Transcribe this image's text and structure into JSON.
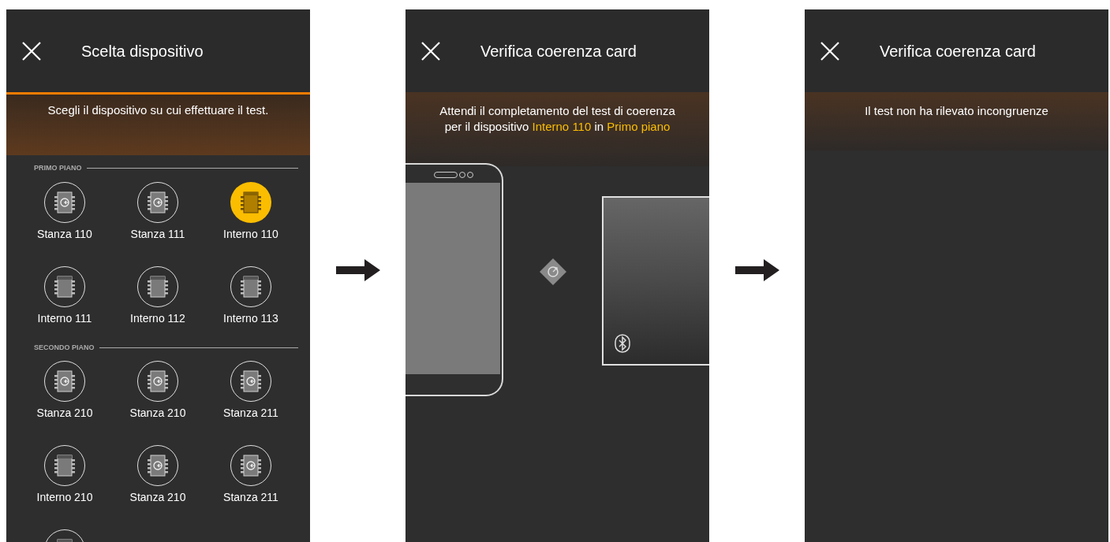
{
  "screens": [
    {
      "kind": "select",
      "title": "Scelta dispositivo",
      "instruction": "Scegli il dispositivo su cui effettuare il test.",
      "sections": [
        {
          "label": "PRIMO PIANO",
          "items": [
            {
              "kind": "room",
              "label": "Stanza 110",
              "selected": false
            },
            {
              "kind": "room",
              "label": "Stanza 111",
              "selected": false
            },
            {
              "kind": "internal",
              "label": "Interno 110",
              "selected": true
            },
            {
              "kind": "internal",
              "label": "Interno 111",
              "selected": false
            },
            {
              "kind": "internal",
              "label": "Interno 112",
              "selected": false
            },
            {
              "kind": "internal",
              "label": "Interno 113",
              "selected": false
            }
          ]
        },
        {
          "label": "SECONDO PIANO",
          "items": [
            {
              "kind": "room",
              "label": "Stanza 210",
              "selected": false
            },
            {
              "kind": "room",
              "label": "Stanza 210",
              "selected": false
            },
            {
              "kind": "room",
              "label": "Stanza 211",
              "selected": false
            },
            {
              "kind": "internal",
              "label": "Interno 210",
              "selected": false
            },
            {
              "kind": "room",
              "label": "Stanza 210",
              "selected": false
            },
            {
              "kind": "room",
              "label": "Stanza 211",
              "selected": false
            },
            {
              "kind": "internal",
              "selected": false
            }
          ]
        }
      ]
    },
    {
      "kind": "progress",
      "title": "Verifica coerenza card",
      "message": [
        [
          {
            "text": "Attendi il completamento del test di coerenza",
            "highlight": false
          }
        ],
        [
          {
            "text": "per il dispositivo ",
            "highlight": false
          },
          {
            "text": "Interno 110",
            "highlight": true
          },
          {
            "text": " in ",
            "highlight": false
          },
          {
            "text": "Primo piano",
            "highlight": true
          }
        ]
      ]
    },
    {
      "kind": "result",
      "title": "Verifica coerenza card",
      "message": [
        [
          {
            "text": "Il test non ha rilevato incongruenze",
            "highlight": false
          }
        ]
      ]
    }
  ]
}
